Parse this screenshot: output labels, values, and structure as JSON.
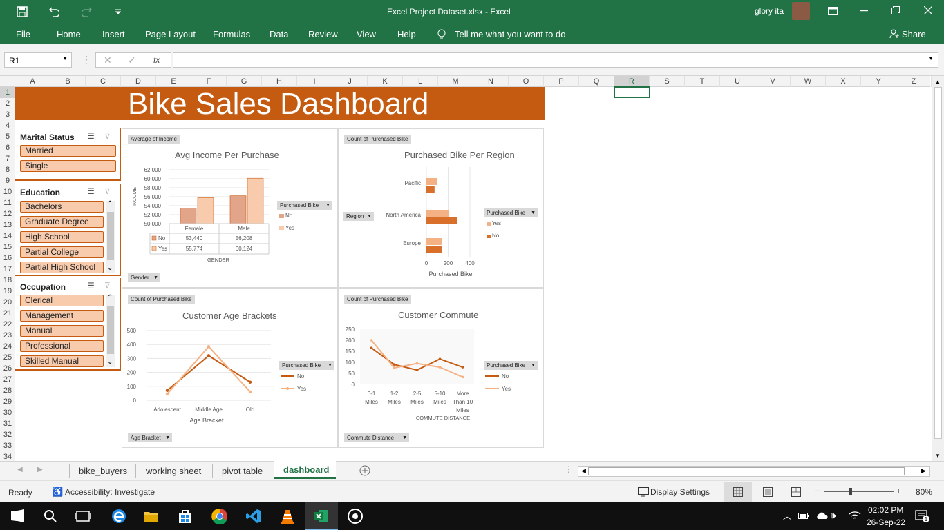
{
  "titlebar": {
    "title": "Excel Project Dataset.xlsx  -  Excel",
    "user": "glory ita"
  },
  "ribbon": {
    "tabs": [
      "File",
      "Home",
      "Insert",
      "Page Layout",
      "Formulas",
      "Data",
      "Review",
      "View",
      "Help"
    ],
    "tell_me": "Tell me what you want to do",
    "share": "Share"
  },
  "formula_bar": {
    "name_box": "R1",
    "fx": "fx",
    "value": ""
  },
  "columns": [
    "A",
    "B",
    "C",
    "D",
    "E",
    "F",
    "G",
    "H",
    "I",
    "J",
    "K",
    "L",
    "M",
    "N",
    "O",
    "P",
    "Q",
    "R",
    "S",
    "T",
    "U",
    "V",
    "W",
    "X",
    "Y",
    "Z"
  ],
  "rows": [
    "1",
    "2",
    "3",
    "4",
    "5",
    "6",
    "7",
    "8",
    "9",
    "10",
    "11",
    "12",
    "13",
    "14",
    "15",
    "16",
    "17",
    "18",
    "19",
    "20",
    "21",
    "22",
    "23",
    "24",
    "25",
    "26",
    "27",
    "28",
    "29",
    "30",
    "31",
    "32",
    "33",
    "34"
  ],
  "dashboard_title": "Bike Sales Dashboard",
  "slicers": {
    "marital": {
      "title": "Marital Status",
      "items": [
        "Married",
        "Single"
      ]
    },
    "education": {
      "title": "Education",
      "items": [
        "Bachelors",
        "Graduate Degree",
        "High School",
        "Partial College",
        "Partial High School"
      ]
    },
    "occupation": {
      "title": "Occupation",
      "items": [
        "Clerical",
        "Management",
        "Manual",
        "Professional",
        "Skilled Manual"
      ]
    }
  },
  "charts": {
    "income": {
      "field": "Average of Income",
      "title": "Avg Income Per Purchase",
      "legend_field": "Purchased Bike",
      "axis_field": "Gender",
      "ylabel": "INCOME",
      "xlabel": "GENDER",
      "legend": [
        "No",
        "Yes"
      ]
    },
    "region": {
      "field": "Count of Purchased Bike",
      "title": "Purchased Bike Per Region",
      "legend_field": "Purchased Bike",
      "axis_field": "Region",
      "xlabel": "Purchased Bike",
      "legend": [
        "Yes",
        "No"
      ]
    },
    "age": {
      "field": "Count of Purchased Bike",
      "title": "Customer Age Brackets",
      "legend_field": "Purchased Bike",
      "axis_field": "Age Bracket",
      "xlabel": "Age Bracket",
      "legend": [
        "No",
        "Yes"
      ]
    },
    "commute": {
      "field": "Count of Purchased Bike",
      "title": "Customer Commute",
      "legend_field": "Purchased Bike",
      "axis_field": "Commute Distance",
      "xlabel": "COMMUTE DISTANCE",
      "legend": [
        "No",
        "Yes"
      ]
    }
  },
  "chart_data": [
    {
      "type": "bar",
      "title": "Avg Income Per Purchase",
      "xlabel": "GENDER",
      "ylabel": "INCOME",
      "categories": [
        "Female",
        "Male"
      ],
      "ylim": [
        50000,
        62000
      ],
      "yticks": [
        "62,000",
        "60,000",
        "58,000",
        "56,000",
        "54,000",
        "52,000",
        "50,000"
      ],
      "series": [
        {
          "name": "No",
          "values": [
            53440,
            56208
          ],
          "labels": [
            "53,440",
            "56,208"
          ],
          "color": "#e3a58a"
        },
        {
          "name": "Yes",
          "values": [
            55774,
            60124
          ],
          "labels": [
            "55,774",
            "60,124"
          ],
          "color": "#f8cbad"
        }
      ]
    },
    {
      "type": "bar",
      "title": "Purchased Bike Per Region",
      "xlabel": "Purchased Bike",
      "categories": [
        "Pacific",
        "North America",
        "Europe"
      ],
      "xlim": [
        0,
        400
      ],
      "xticks": [
        "0",
        "200",
        "400"
      ],
      "series": [
        {
          "name": "Yes",
          "values": [
            100,
            210,
            145
          ],
          "color": "#f4b183"
        },
        {
          "name": "No",
          "values": [
            75,
            280,
            145
          ],
          "color": "#d86f2a"
        }
      ]
    },
    {
      "type": "line",
      "title": "Customer Age Brackets",
      "xlabel": "Age Bracket",
      "categories": [
        "Adolescent",
        "Middle Age",
        "Old"
      ],
      "ylim": [
        0,
        500
      ],
      "yticks": [
        "500",
        "400",
        "300",
        "200",
        "100",
        "0"
      ],
      "series": [
        {
          "name": "No",
          "values": [
            70,
            320,
            130
          ],
          "color": "#c55a11"
        },
        {
          "name": "Yes",
          "values": [
            45,
            385,
            60
          ],
          "color": "#f4b183"
        }
      ]
    },
    {
      "type": "line",
      "title": "Customer Commute",
      "xlabel": "COMMUTE DISTANCE",
      "categories": [
        "0-1 Miles",
        "1-2 Miles",
        "2-5 Miles",
        "5-10 Miles",
        "More Than 10 Miles"
      ],
      "ylim": [
        0,
        250
      ],
      "yticks": [
        "250",
        "200",
        "150",
        "100",
        "50",
        "0"
      ],
      "series": [
        {
          "name": "No",
          "values": [
            165,
            90,
            65,
            115,
            78
          ],
          "color": "#c55a11"
        },
        {
          "name": "Yes",
          "values": [
            200,
            75,
            95,
            78,
            33
          ],
          "color": "#f4b183"
        }
      ]
    }
  ],
  "sheet_tabs": [
    "bike_buyers",
    "working sheet",
    "pivot table",
    "dashboard"
  ],
  "active_sheet": "dashboard",
  "status": {
    "ready": "Ready",
    "accessibility": "Accessibility: Investigate",
    "display_settings": "Display Settings",
    "zoom": "80%"
  },
  "taskbar": {
    "time": "02:02 PM",
    "date": "26-Sep-22"
  }
}
